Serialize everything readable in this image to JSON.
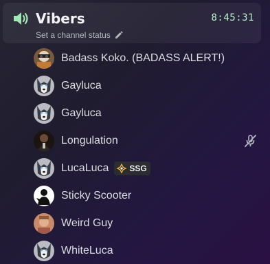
{
  "channel": {
    "name": "Vibers",
    "time": "8:45:31",
    "status_prompt": "Set a channel status",
    "speaker_icon": "speaker-icon",
    "pencil_icon": "pencil-icon"
  },
  "members": [
    {
      "name": "Badass Koko. (BADASS ALERT!)",
      "avatar": "avatar-koko"
    },
    {
      "name": "Gayluca",
      "avatar": "avatar-husky"
    },
    {
      "name": "Gayluca",
      "avatar": "avatar-husky"
    },
    {
      "name": "Longulation",
      "avatar": "avatar-dark",
      "muted": true
    },
    {
      "name": "LucaLuca",
      "avatar": "avatar-husky",
      "badge": {
        "icon": "diamond-logo-icon",
        "text": "SSG"
      }
    },
    {
      "name": "Sticky Scooter",
      "avatar": "avatar-silhouette"
    },
    {
      "name": "Weird Guy",
      "avatar": "avatar-warm"
    },
    {
      "name": "WhiteLuca",
      "avatar": "avatar-husky"
    }
  ],
  "colors": {
    "accent_green": "#b5f4c8",
    "speaker": "#a3e6b6",
    "badge_gold": "#e9b43a"
  }
}
